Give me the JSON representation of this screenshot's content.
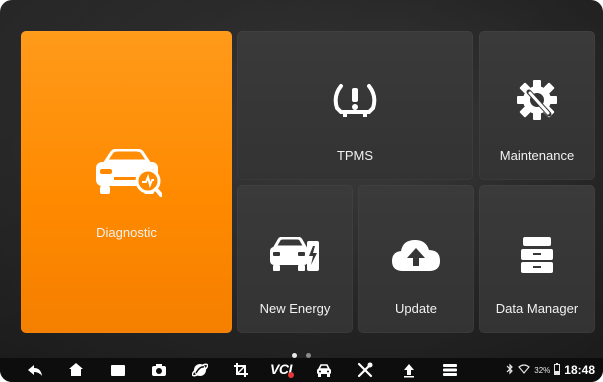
{
  "tiles": {
    "diagnostic": {
      "label": "Diagnostic",
      "icon": "car-diagnostic-icon"
    },
    "tpms": {
      "label": "TPMS",
      "icon": "tire-pressure-icon"
    },
    "maintenance": {
      "label": "Maintenance",
      "icon": "wrench-gear-icon"
    },
    "new_energy": {
      "label": "New Energy",
      "icon": "ev-charging-car-icon"
    },
    "update": {
      "label": "Update",
      "icon": "cloud-upload-icon"
    },
    "data_manager": {
      "label": "Data Manager",
      "icon": "drawer-cabinet-icon"
    }
  },
  "pager": {
    "pages": 2,
    "active": 1
  },
  "taskbar": {
    "icons": [
      "back-icon",
      "home-icon",
      "recent-apps-icon",
      "camera-icon",
      "browser-icon",
      "crop-icon",
      "vci-icon",
      "car-icon",
      "tools-icon",
      "upload-icon",
      "menu-icon"
    ],
    "vci_label": "VCI"
  },
  "status": {
    "battery": "32%",
    "time": "18:48"
  },
  "colors": {
    "accent": "#ff8a00",
    "tile": "#363636",
    "background": "#262626",
    "taskbar": "#0d0d0d"
  }
}
